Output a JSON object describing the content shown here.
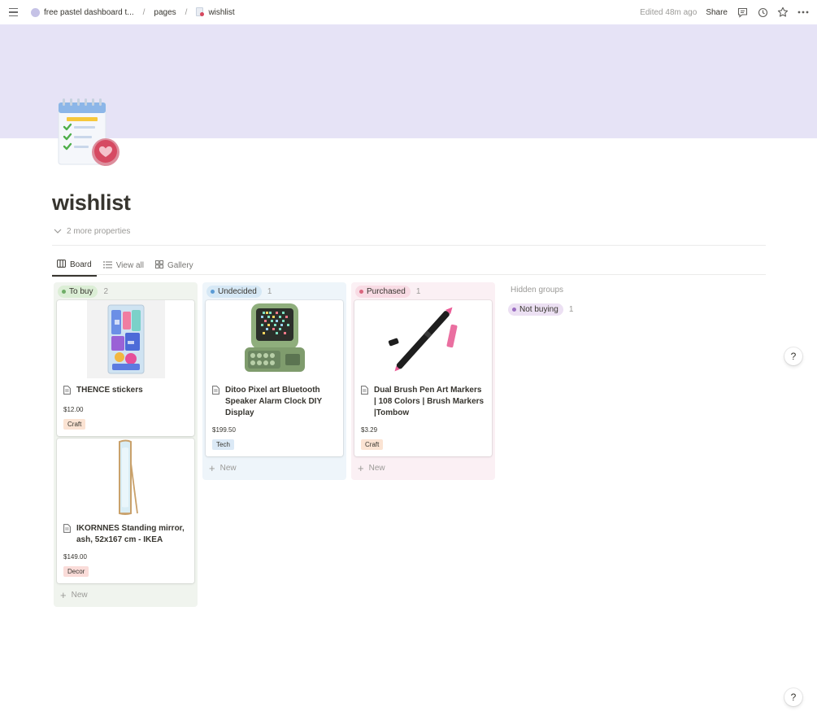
{
  "topbar": {
    "workspace": "free pastel dashboard t...",
    "crumb_pages": "pages",
    "crumb_current": "wishlist",
    "edited": "Edited 48m ago",
    "share": "Share"
  },
  "page": {
    "title": "wishlist",
    "more_properties": "2 more properties"
  },
  "views": [
    {
      "label": "Board",
      "icon": "board-icon",
      "active": true
    },
    {
      "label": "View all",
      "icon": "list-icon"
    },
    {
      "label": "Gallery",
      "icon": "gallery-icon"
    }
  ],
  "board": {
    "hidden_groups_label": "Hidden groups",
    "new_label": "New",
    "columns": [
      {
        "name": "To buy",
        "count": "2",
        "bg": "#f0f4ee",
        "pill": "#dbeed5",
        "dot": "#6fae67",
        "cards": [
          {
            "title": "THENCE stickers",
            "price": "$12.00",
            "tag": "Craft",
            "tag_bg": "#fbe3d3",
            "image": "sticker-pack"
          },
          {
            "title": "IKORNNES Standing mirror, ash, 52x167 cm - IKEA",
            "price": "$149.00",
            "tag": "Decor",
            "tag_bg": "#fadcd9",
            "image": "standing-mirror"
          }
        ]
      },
      {
        "name": "Undecided",
        "count": "1",
        "bg": "#eef5fa",
        "pill": "#d6e8f5",
        "dot": "#5a9bd5",
        "cards": [
          {
            "title": "Ditoo Pixel art Bluetooth Speaker Alarm Clock DIY Display",
            "price": "$199.50",
            "tag": "Tech",
            "tag_bg": "#dbe9f6",
            "image": "pixel-speaker"
          }
        ]
      },
      {
        "name": "Purchased",
        "count": "1",
        "bg": "#fbf0f4",
        "pill": "#f8dbe4",
        "dot": "#d9667e",
        "cards": [
          {
            "title": "Dual Brush Pen Art Markers | 108 Colors | Brush Markers |Tombow",
            "price": "$3.29",
            "tag": "Craft",
            "tag_bg": "#fbe3d3",
            "image": "brush-pen"
          }
        ]
      }
    ],
    "hidden": [
      {
        "name": "Not buying",
        "count": "1",
        "pill": "#ece0f3",
        "dot": "#9b6fc2"
      }
    ]
  },
  "help": "?"
}
